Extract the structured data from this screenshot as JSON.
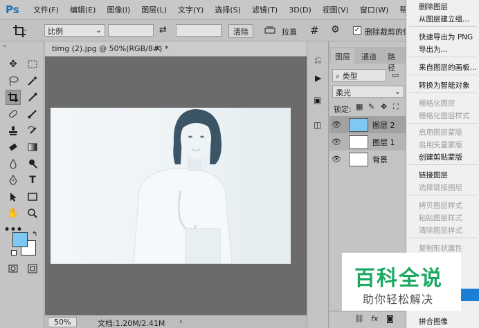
{
  "menubar": {
    "logo": "Ps",
    "items": [
      "文件(F)",
      "编辑(E)",
      "图像(I)",
      "图层(L)",
      "文字(Y)",
      "选择(S)",
      "滤镜(T)",
      "3D(D)",
      "视图(V)",
      "窗口(W)",
      "帮助(H)"
    ]
  },
  "options": {
    "ratio": "比例",
    "clear": "清除",
    "straighten": "拉直",
    "delete_cropped": "删除裁剪的像"
  },
  "document": {
    "tab_label": "timg (2).jpg @ 50%(RGB/8#) *",
    "close": "×",
    "zoom": "50%",
    "doc_info": "文档:1.20M/2.41M"
  },
  "layers_panel": {
    "tabs": [
      "图层",
      "通道",
      "路径"
    ],
    "filter_kind": "类型",
    "blend_mode": "柔光",
    "lock_label": "锁定:",
    "layers": [
      {
        "name": "图层 2",
        "thumb": "#7ec8f2"
      },
      {
        "name": "图层 1",
        "thumb": "#ffffff"
      },
      {
        "name": "背景",
        "thumb": "#ffffff"
      }
    ]
  },
  "context_menu": {
    "items": [
      {
        "label": "删除图层",
        "enabled": true
      },
      {
        "label": "从图层建立组...",
        "enabled": true
      },
      {
        "label": "快速导出为 PNG",
        "enabled": true
      },
      {
        "label": "导出为...",
        "enabled": true
      },
      {
        "label": "来自图层的画板...",
        "enabled": true
      },
      {
        "label": "转换为智能对象",
        "enabled": true
      },
      {
        "label": "栅格化图层",
        "enabled": false
      },
      {
        "label": "栅格化图层样式",
        "enabled": false
      },
      {
        "label": "启用图层蒙版",
        "enabled": false
      },
      {
        "label": "启用矢量蒙版",
        "enabled": false
      },
      {
        "label": "创建剪贴蒙版",
        "enabled": true
      },
      {
        "label": "链接图层",
        "enabled": true
      },
      {
        "label": "选择链接图层",
        "enabled": false
      },
      {
        "label": "拷贝图层样式",
        "enabled": false
      },
      {
        "label": "粘贴图层样式",
        "enabled": false
      },
      {
        "label": "清除图层样式",
        "enabled": false
      },
      {
        "label": "复制形状属性",
        "enabled": false
      },
      {
        "label": "拼合图像",
        "enabled": true
      }
    ]
  },
  "watermark": {
    "title": "百科全说",
    "subtitle": "助你轻松解决"
  },
  "colors": {
    "foreground": "#7ec8f2",
    "background": "#ffffff",
    "watermark_green": "#19a960"
  }
}
